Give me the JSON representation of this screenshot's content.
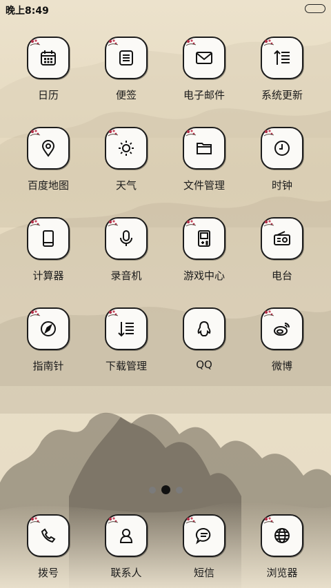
{
  "status_bar": {
    "time": "晚上8:49"
  },
  "colors": {
    "paper": "#ece2cc",
    "ink": "#1c1c1c",
    "tile": "#fbfaf7",
    "blossom": "#b2324a"
  },
  "apps": [
    {
      "label": "日历",
      "icon": "calendar-icon"
    },
    {
      "label": "便签",
      "icon": "notes-icon"
    },
    {
      "label": "电子邮件",
      "icon": "mail-icon"
    },
    {
      "label": "系统更新",
      "icon": "system-update-icon"
    },
    {
      "label": "百度地图",
      "icon": "map-pin-icon"
    },
    {
      "label": "天气",
      "icon": "sun-icon"
    },
    {
      "label": "文件管理",
      "icon": "folder-icon"
    },
    {
      "label": "时钟",
      "icon": "clock-icon"
    },
    {
      "label": "计算器",
      "icon": "calculator-icon"
    },
    {
      "label": "录音机",
      "icon": "microphone-icon"
    },
    {
      "label": "游戏中心",
      "icon": "game-console-icon"
    },
    {
      "label": "电台",
      "icon": "radio-icon"
    },
    {
      "label": "指南针",
      "icon": "compass-icon"
    },
    {
      "label": "下载管理",
      "icon": "download-list-icon"
    },
    {
      "label": "QQ",
      "icon": "qq-penguin-icon"
    },
    {
      "label": "微博",
      "icon": "weibo-icon"
    }
  ],
  "page_indicator": {
    "pages": 3,
    "current": 2
  },
  "dock": [
    {
      "label": "拨号",
      "icon": "phone-icon"
    },
    {
      "label": "联系人",
      "icon": "contact-icon"
    },
    {
      "label": "短信",
      "icon": "message-icon"
    },
    {
      "label": "浏览器",
      "icon": "globe-icon"
    }
  ]
}
